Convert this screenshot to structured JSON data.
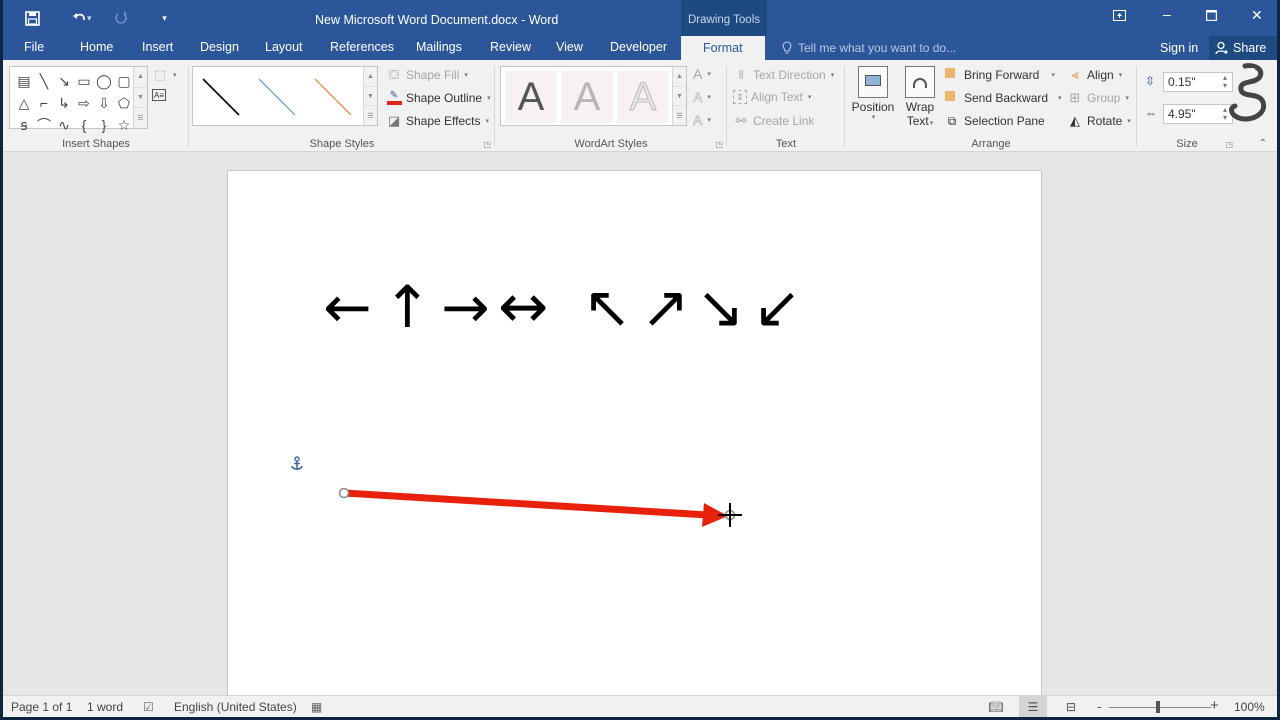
{
  "app": {
    "title": "New Microsoft Word Document.docx - Word",
    "context_tab": "Drawing Tools"
  },
  "qat": {
    "save_icon": "save-icon",
    "undo_icon": "undo-icon",
    "redo_icon": "redo-icon",
    "customize_icon": "customize-qat-icon"
  },
  "tabs": [
    {
      "label": "File"
    },
    {
      "label": "Home"
    },
    {
      "label": "Insert"
    },
    {
      "label": "Design"
    },
    {
      "label": "Layout"
    },
    {
      "label": "References"
    },
    {
      "label": "Mailings"
    },
    {
      "label": "Review"
    },
    {
      "label": "View"
    },
    {
      "label": "Developer"
    },
    {
      "label": "Format",
      "active": true
    }
  ],
  "tell_me": {
    "placeholder": "Tell me what you want to do..."
  },
  "account": {
    "signin": "Sign in",
    "share": "Share"
  },
  "ribbon": {
    "insert_shapes": {
      "label": "Insert Shapes",
      "shapes": [
        "▤",
        "╲",
        "↘",
        "▭",
        "◯",
        "▢",
        "△",
        "⌐",
        "↳",
        "⇨",
        "⇩",
        "⬠",
        "ꞩ",
        "⌒",
        "∿",
        "{",
        "}",
        "☆"
      ]
    },
    "shape_styles": {
      "label": "Shape Styles",
      "presets": [
        {
          "color": "#000000"
        },
        {
          "color": "#5b9bd5"
        },
        {
          "color": "#ed7d31"
        }
      ],
      "fill": "Shape Fill",
      "outline": "Shape Outline",
      "effects": "Shape Effects",
      "outline_color": "#e0261a"
    },
    "wordart_styles": {
      "label": "WordArt Styles",
      "tiles": [
        "A",
        "A",
        "A"
      ]
    },
    "text": {
      "label": "Text",
      "direction": "Text Direction",
      "align": "Align Text",
      "link": "Create Link"
    },
    "arrange": {
      "label": "Arrange",
      "position": "Position",
      "wrap_line1": "Wrap",
      "wrap_line2": "Text",
      "bring_forward": "Bring Forward",
      "send_backward": "Send Backward",
      "selection_pane": "Selection Pane",
      "align": "Align",
      "group": "Group",
      "rotate": "Rotate"
    },
    "size": {
      "label": "Size",
      "height": "0.15\"",
      "width": "4.95\""
    }
  },
  "document": {
    "arrow_symbols": [
      "←",
      "↑",
      "→",
      "↔",
      "↖",
      "↗",
      "↘",
      "↙"
    ],
    "shape": {
      "type": "arrow",
      "color": "#e8210d"
    }
  },
  "status": {
    "page": "Page 1 of 1",
    "words": "1 word",
    "language": "English (United States)",
    "zoom": "100%",
    "zoom_minus": "-",
    "zoom_plus": "+"
  }
}
